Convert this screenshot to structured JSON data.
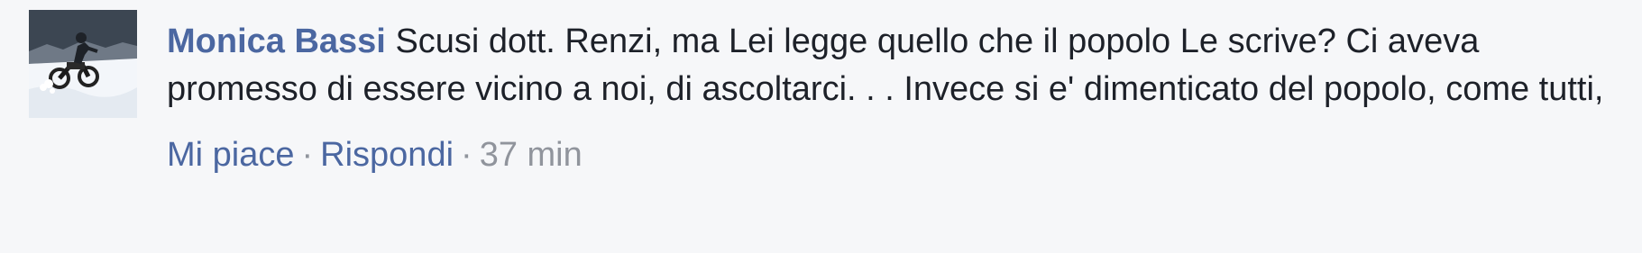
{
  "comment": {
    "author": "Monica Bassi",
    "text": "Scusi dott. Renzi, ma Lei legge quello che il popolo Le scrive? Ci aveva promesso di essere vicino a noi, di ascoltarci. . . Invece si e' dimenticato del popolo, come tutti,",
    "actions": {
      "like_label": "Mi piace",
      "reply_label": "Rispondi",
      "separator": "·",
      "timestamp": "37 min"
    }
  },
  "colors": {
    "link": "#4b67a1",
    "text": "#1d2129",
    "meta": "#90949c",
    "background": "#f6f7f9"
  },
  "icons": {
    "avatar": "profile-photo-motorcycle-snow"
  }
}
